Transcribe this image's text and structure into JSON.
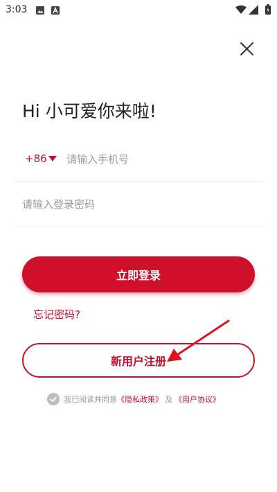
{
  "status_bar": {
    "time": "3:03",
    "icons": [
      "image-icon",
      "a-letter-icon",
      "wifi-icon",
      "signal-icon",
      "battery-icon"
    ]
  },
  "header": {
    "close_icon": "close-icon"
  },
  "greeting": "Hi 小可爱你来啦!",
  "phone": {
    "country_code": "+86",
    "placeholder": "请输入手机号",
    "value": ""
  },
  "password": {
    "placeholder": "请输入登录密码",
    "value": ""
  },
  "login_label": "立即登录",
  "forgot_label": "忘记密码?",
  "register_label": "新用户注册",
  "agreement": {
    "prefix": "我已阅读并同意",
    "privacy_link": "《隐私政策》",
    "separator": "及",
    "user_link": "《用户协议》",
    "checked": true
  },
  "colors": {
    "brand": "#d0102a",
    "text": "#222222",
    "placeholder": "#9a9a9a",
    "checkbox": "#bdbdbd"
  }
}
